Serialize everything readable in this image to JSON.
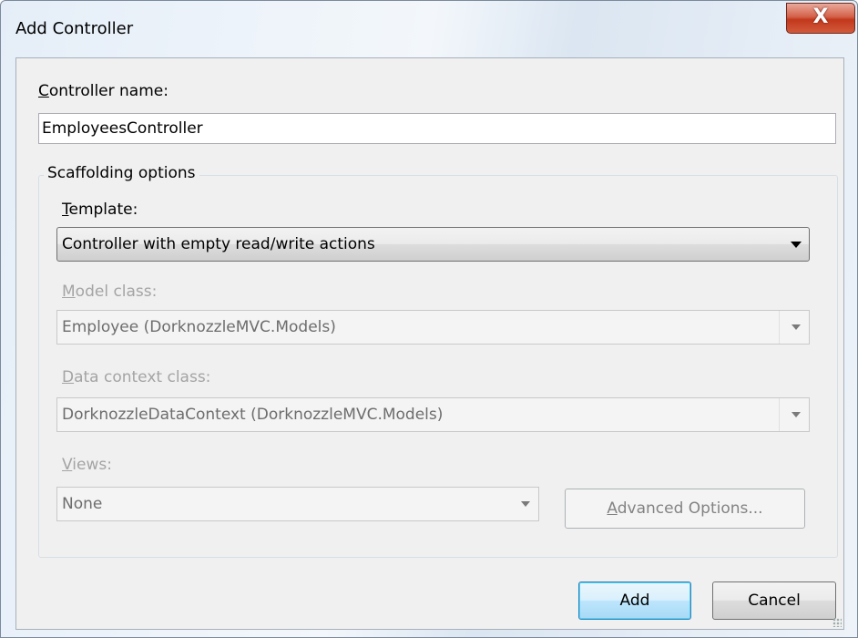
{
  "window": {
    "title": "Add Controller",
    "close_glyph": "X"
  },
  "controller_name": {
    "label_accel": "C",
    "label_rest": "ontroller name:",
    "value": "EmployeesController"
  },
  "scaffolding": {
    "legend": "Scaffolding options",
    "template": {
      "label_accel": "T",
      "label_rest": "emplate:",
      "selected": "Controller with empty read/write actions"
    },
    "model_class": {
      "label_accel": "M",
      "label_rest": "odel class:",
      "selected": "Employee (DorknozzleMVC.Models)"
    },
    "data_context": {
      "label_accel": "D",
      "label_rest": "ata context class:",
      "selected": "DorknozzleDataContext (DorknozzleMVC.Models)"
    },
    "views": {
      "label_accel": "V",
      "label_rest": "iews:",
      "selected": "None"
    },
    "advanced_button": {
      "label_accel": "A",
      "label_rest": "dvanced Options..."
    }
  },
  "buttons": {
    "add": "Add",
    "cancel": "Cancel"
  },
  "colors": {
    "close_button": "#c2381c",
    "default_button_border": "#3c7fb1",
    "disabled_text": "#a4a4a4"
  },
  "icons": {
    "close": "close-icon",
    "dropdown": "chevron-down-icon"
  }
}
